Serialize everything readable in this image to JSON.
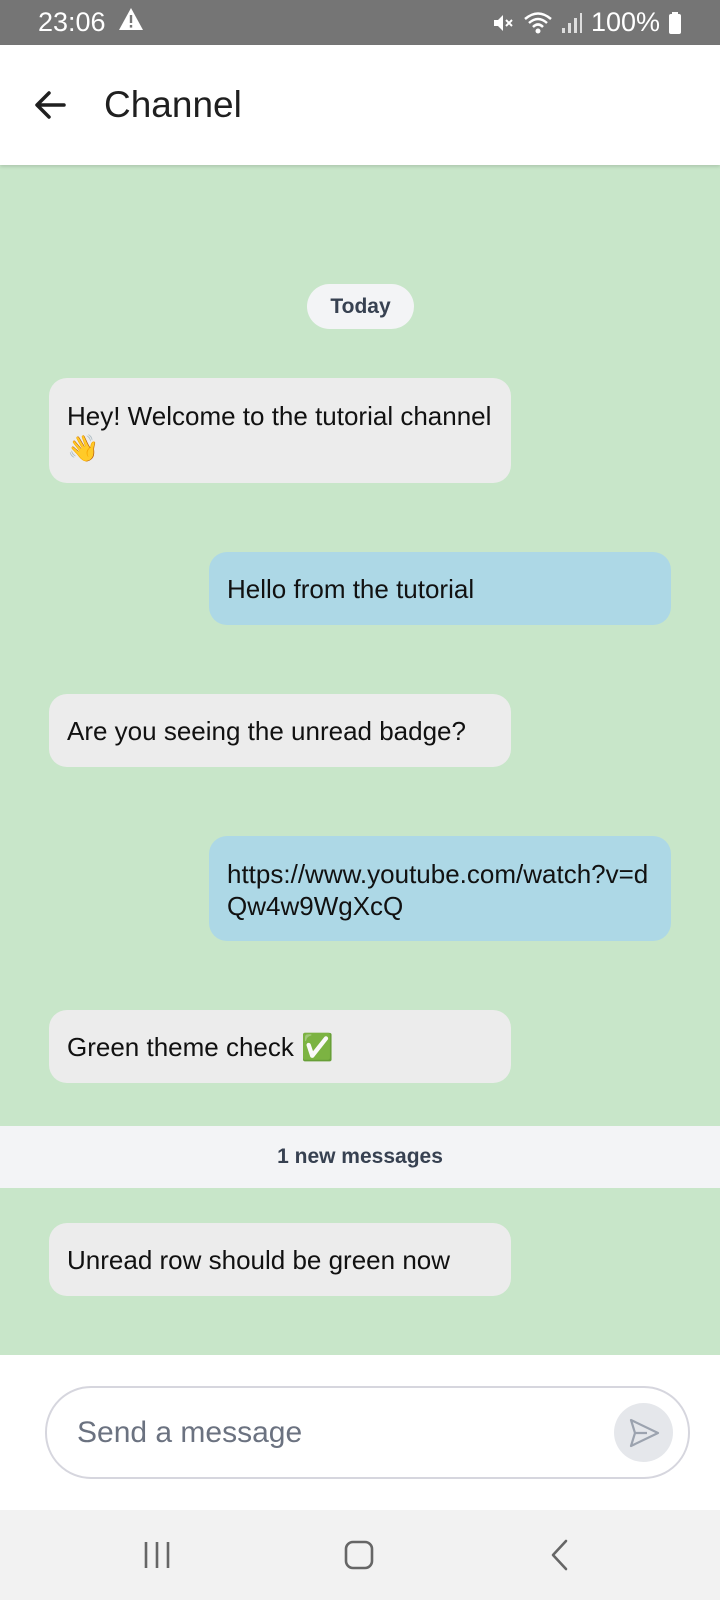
{
  "status_bar": {
    "time": "23:06",
    "battery": "100%",
    "icons": [
      "warning-icon",
      "mute-icon",
      "wifi-icon",
      "signal-icon",
      "battery-icon"
    ]
  },
  "app_bar": {
    "title": "Channel",
    "back_icon": "arrow-left-icon"
  },
  "chat": {
    "background_color": "#c8e6c9",
    "date_separator": "Today",
    "messages": [
      {
        "direction": "incoming",
        "text": "Hey! Welcome to the tutorial channel 👋"
      },
      {
        "direction": "outgoing",
        "text": "Hello from the tutorial"
      },
      {
        "direction": "incoming",
        "text": "Are you seeing the unread badge?"
      },
      {
        "direction": "outgoing",
        "text": "https://www.youtube.com/watch?v=dQw4w9WgXcQ"
      },
      {
        "direction": "incoming",
        "text": "Green theme check ✅"
      },
      {
        "direction": "incoming",
        "text": "Unread row should be green now"
      }
    ],
    "unread_separator": "1 new messages",
    "incoming_color": "#ececec",
    "outgoing_color": "#add8e6"
  },
  "composer": {
    "placeholder": "Send a message",
    "value": "",
    "send_icon": "send-icon"
  },
  "nav_bar": {
    "icons": [
      "recent-apps-icon",
      "home-icon",
      "back-icon"
    ]
  }
}
